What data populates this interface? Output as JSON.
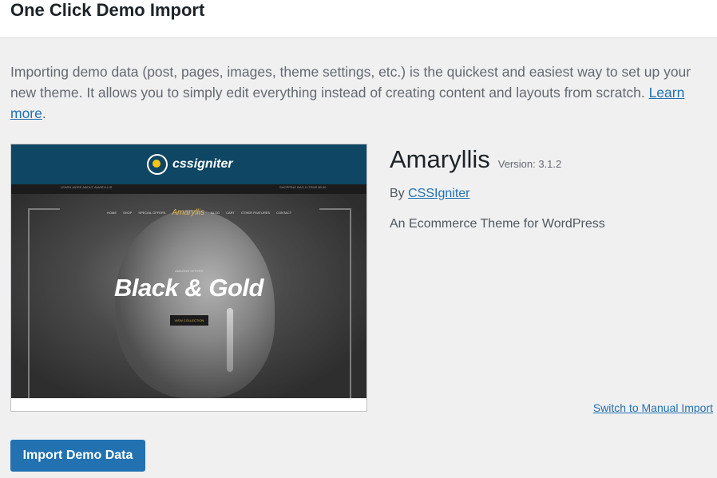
{
  "header": {
    "title": "One Click Demo Import"
  },
  "intro": {
    "text": "Importing demo data (post, pages, images, theme settings, etc.) is the quickest and easiest way to set up your new theme. It allows you to simply edit everything instead of creating content and layouts from scratch. ",
    "link_label": "Learn more",
    "trailing": "."
  },
  "preview": {
    "logo_text": "cssigniter",
    "top_left_note": "LEARN MORE ABOUT AMARYLLIS",
    "top_right_note": "SHOPPING BAG 0 ITEMS $0.00",
    "nav_items": [
      "HOME",
      "SHOP",
      "SPECIAL OFFERS"
    ],
    "nav_brand": "Amaryllis",
    "nav_items_right": [
      "BLOG",
      "CART",
      "OTHER FEATURES",
      "CONTACT"
    ],
    "offer": "AMAZING OFFERS",
    "headline": "Black & Gold",
    "cta": "VIEW COLLECTION"
  },
  "theme": {
    "name": "Amaryllis",
    "version": "Version: 3.1.2",
    "by_label": "By",
    "author": "CSSIgniter",
    "description": "An Ecommerce Theme for WordPress"
  },
  "actions": {
    "switch_label": "Switch to Manual Import",
    "import_label": "Import Demo Data"
  }
}
